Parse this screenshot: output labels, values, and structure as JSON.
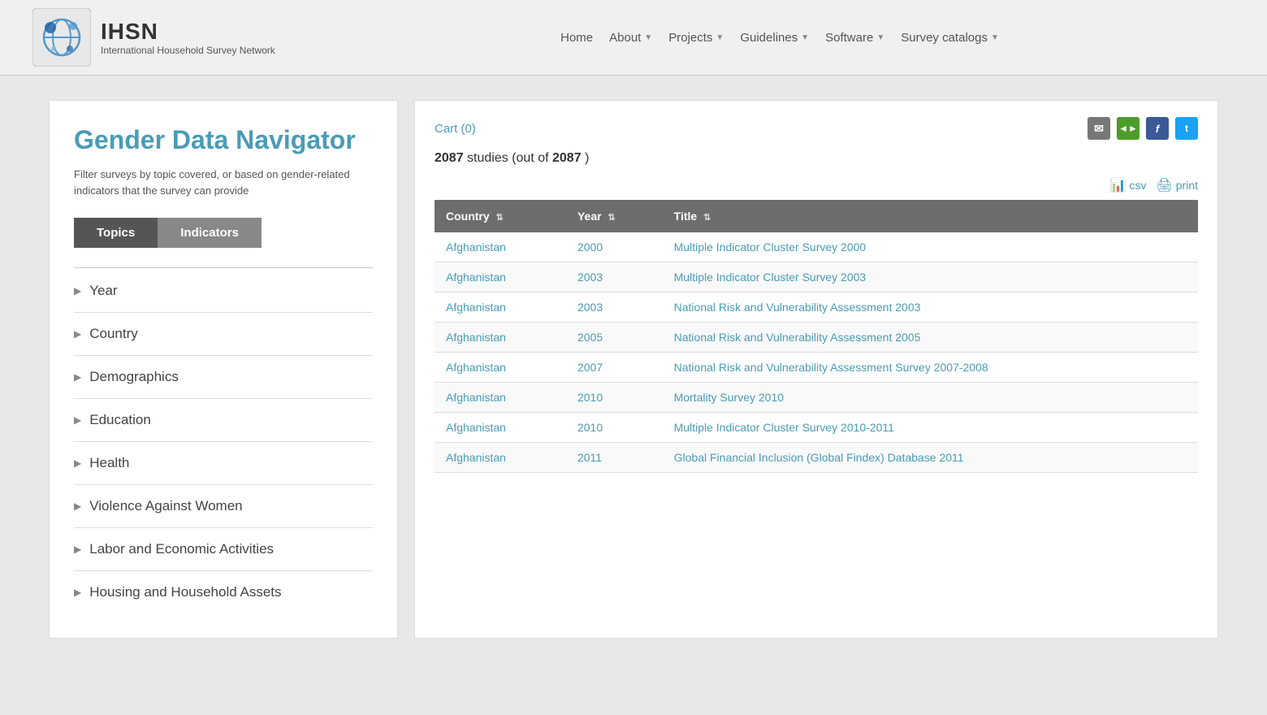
{
  "header": {
    "logo_title": "IHSN",
    "logo_subtitle": "International Household Survey Network",
    "nav_items": [
      {
        "label": "Home",
        "has_arrow": false
      },
      {
        "label": "About",
        "has_arrow": true
      },
      {
        "label": "Projects",
        "has_arrow": true
      },
      {
        "label": "Guidelines",
        "has_arrow": true
      },
      {
        "label": "Software",
        "has_arrow": true
      },
      {
        "label": "Survey catalogs",
        "has_arrow": true
      }
    ]
  },
  "left_panel": {
    "title": "Gender Data Navigator",
    "subtitle": "Filter surveys by topic covered, or based on gender-related indicators that the survey can provide",
    "tab_active": "Topics",
    "tab_inactive": "Indicators",
    "filters": [
      {
        "label": "Year"
      },
      {
        "label": "Country"
      },
      {
        "label": "Demographics"
      },
      {
        "label": "Education"
      },
      {
        "label": "Health"
      },
      {
        "label": "Violence Against Women"
      },
      {
        "label": "Labor and Economic Activities"
      },
      {
        "label": "Housing and Household Assets"
      }
    ]
  },
  "right_panel": {
    "cart_label": "Cart (0)",
    "studies_count": "2087",
    "studies_total": "2087",
    "studies_text": "studies (out of",
    "export_csv": "csv",
    "export_print": "print",
    "table": {
      "columns": [
        {
          "label": "Country",
          "key": "country"
        },
        {
          "label": "Year",
          "key": "year"
        },
        {
          "label": "Title",
          "key": "title"
        }
      ],
      "rows": [
        {
          "country": "Afghanistan",
          "year": "2000",
          "title": "Multiple Indicator Cluster Survey 2000"
        },
        {
          "country": "Afghanistan",
          "year": "2003",
          "title": "Multiple Indicator Cluster Survey 2003"
        },
        {
          "country": "Afghanistan",
          "year": "2003",
          "title": "National Risk and Vulnerability Assessment 2003"
        },
        {
          "country": "Afghanistan",
          "year": "2005",
          "title": "National Risk and Vulnerability Assessment 2005"
        },
        {
          "country": "Afghanistan",
          "year": "2007",
          "title": "National Risk and Vulnerability Assessment Survey 2007-2008"
        },
        {
          "country": "Afghanistan",
          "year": "2010",
          "title": "Mortality Survey 2010"
        },
        {
          "country": "Afghanistan",
          "year": "2010",
          "title": "Multiple Indicator Cluster Survey 2010-2011"
        },
        {
          "country": "Afghanistan",
          "year": "2011",
          "title": "Global Financial Inclusion (Global Findex) Database 2011"
        }
      ]
    }
  },
  "icons": {
    "email": "✉",
    "share": "◄",
    "facebook": "f",
    "twitter": "t",
    "csv_icon": "📊",
    "print_icon": "🖨"
  }
}
